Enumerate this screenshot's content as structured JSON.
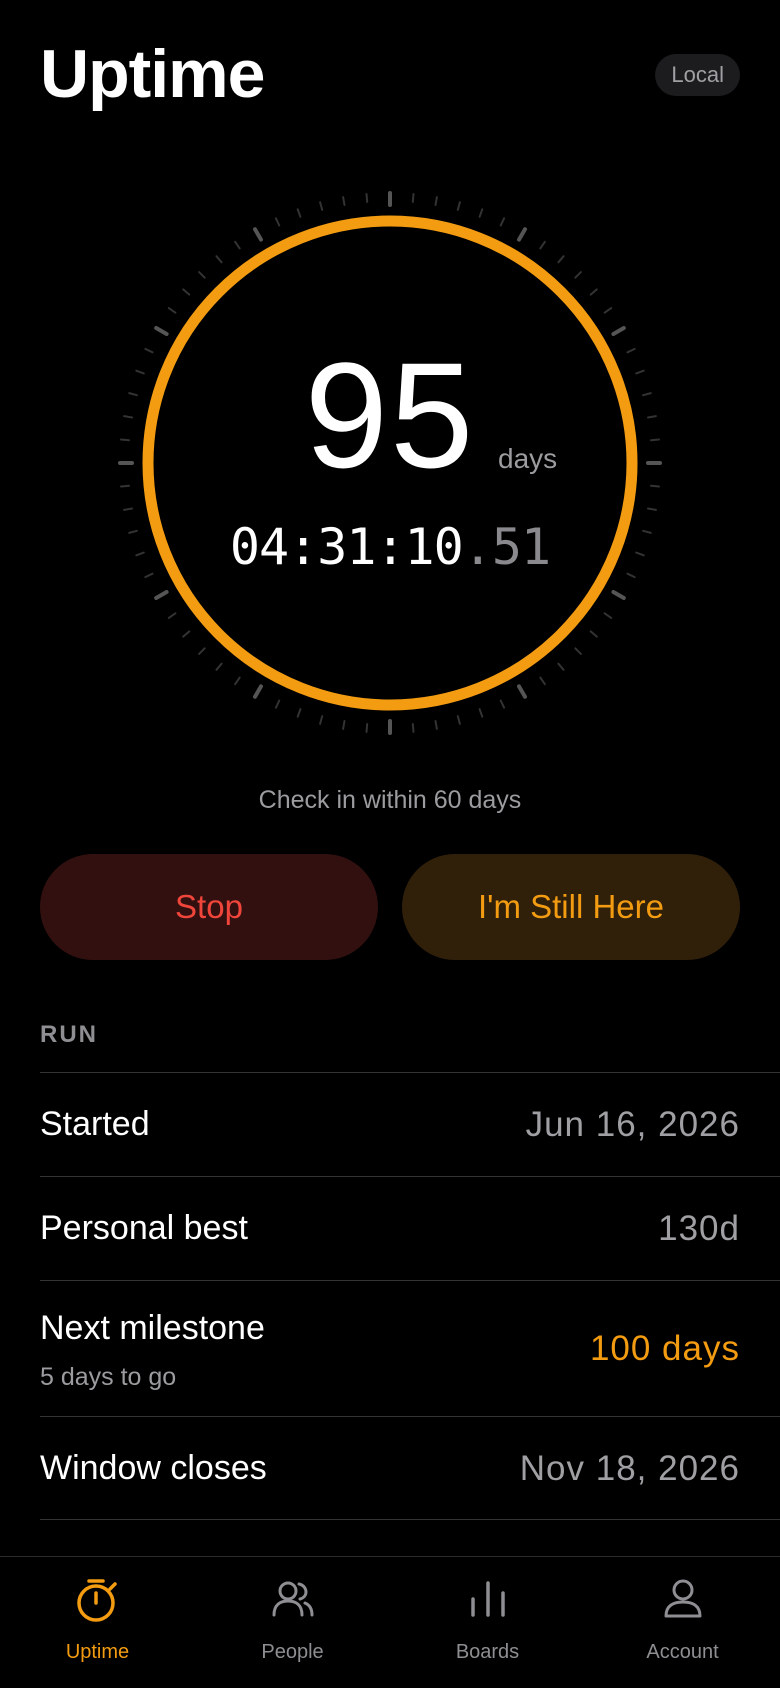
{
  "header": {
    "title": "Uptime",
    "badge": "Local"
  },
  "timer": {
    "days": "95",
    "days_unit": "days",
    "clock_main": "04:31:10",
    "clock_fraction": ".51",
    "ring_color": "#f39c12"
  },
  "checkin_text": "Check in within 60 days",
  "actions": {
    "stop_label": "Stop",
    "still_here_label": "I'm Still Here"
  },
  "run": {
    "section_title": "RUN",
    "rows": [
      {
        "label": "Started",
        "value": "Jun 16, 2026"
      },
      {
        "label": "Personal best",
        "value": "130d"
      },
      {
        "label": "Next milestone",
        "sublabel": "5 days to go",
        "value": "100 days"
      },
      {
        "label": "Window closes",
        "value": "Nov 18, 2026"
      }
    ]
  },
  "tabs": [
    {
      "label": "Uptime",
      "icon": "stopwatch-icon",
      "active": true
    },
    {
      "label": "People",
      "icon": "people-icon",
      "active": false
    },
    {
      "label": "Boards",
      "icon": "bar-chart-icon",
      "active": false
    },
    {
      "label": "Account",
      "icon": "person-icon",
      "active": false
    }
  ],
  "colors": {
    "accent": "#f39c12",
    "danger": "#f0453a"
  }
}
